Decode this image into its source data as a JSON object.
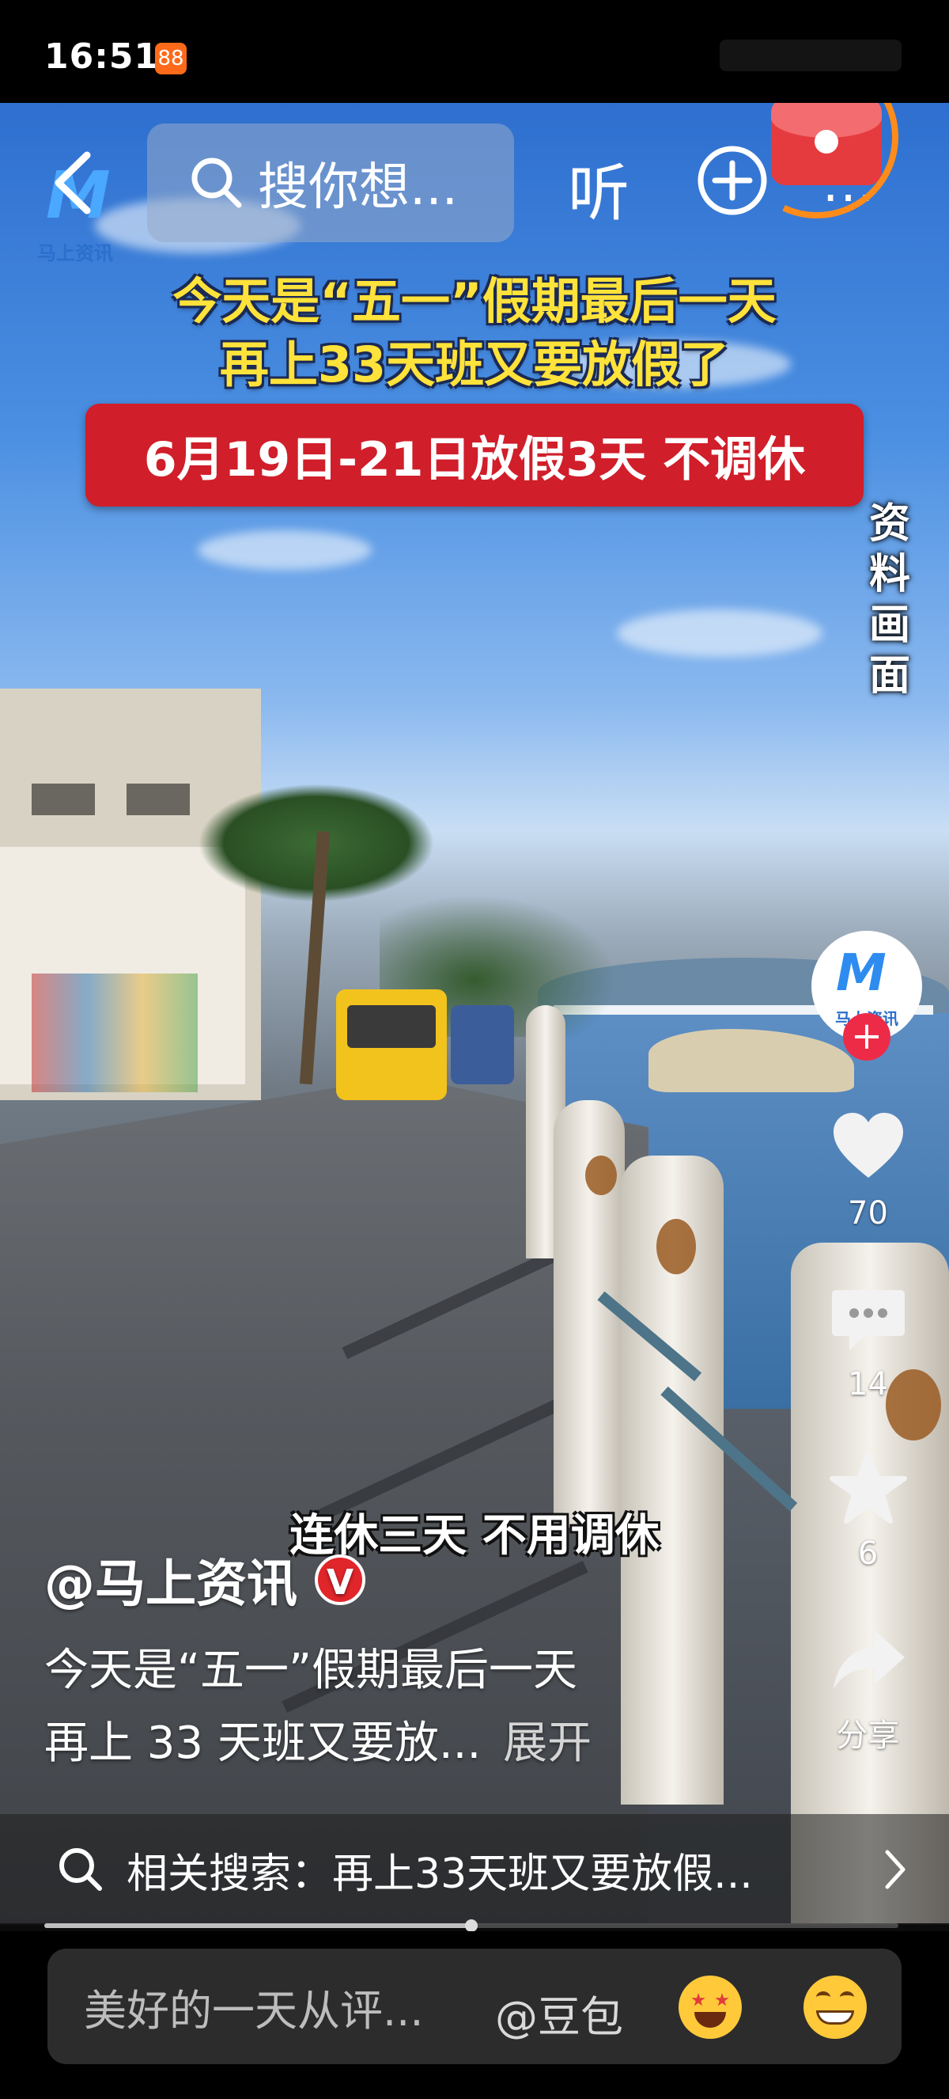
{
  "status_bar": {
    "time": "16:51",
    "app_badge": "88"
  },
  "top_nav": {
    "search_placeholder": "搜你想...",
    "listen_label": "听",
    "more_label": "..."
  },
  "video_overlay": {
    "watermark_logo_letter": "M",
    "watermark_logo_text": "马上资讯",
    "headline_line1": "今天是“五一”假期最后一天",
    "headline_line2": "再上33天班又要放假了",
    "banner_text": "6月19日-21日放假3天 不调休",
    "side_label": "资料画面",
    "subtitle": "连休三天 不用调休"
  },
  "right_actions": {
    "avatar_letter": "M",
    "avatar_text": "马上资讯",
    "follow_label": "+",
    "like_count": "70",
    "comment_count": "14",
    "favorite_count": "6",
    "share_label": "分享"
  },
  "description": {
    "author": "@马上资讯",
    "verified_badge": "V",
    "line1": "今天是“五一”假期最后一天",
    "line2": "再上 33 天班又要放...",
    "expand_label": "展开"
  },
  "related_search": {
    "text": "相关搜索：再上33天班又要放假..."
  },
  "playback": {
    "progress": 0.5
  },
  "comment_bar": {
    "placeholder": "美好的一天从评...",
    "mention": "@豆包"
  },
  "icons": {
    "back": "chevron-left-icon",
    "search": "search-icon",
    "plus": "plus-circle-icon",
    "like": "heart-icon",
    "comment": "comment-icon",
    "favorite": "star-icon",
    "share": "share-arrow-icon",
    "emoji1": "star-eyes-emoji-icon",
    "emoji2": "grin-emoji-icon"
  },
  "colors": {
    "accent_red": "#d01e2a",
    "headline_yellow": "#ffe23a",
    "follow_pink": "#ee2b47",
    "status_orange": "#ff6a1a"
  }
}
